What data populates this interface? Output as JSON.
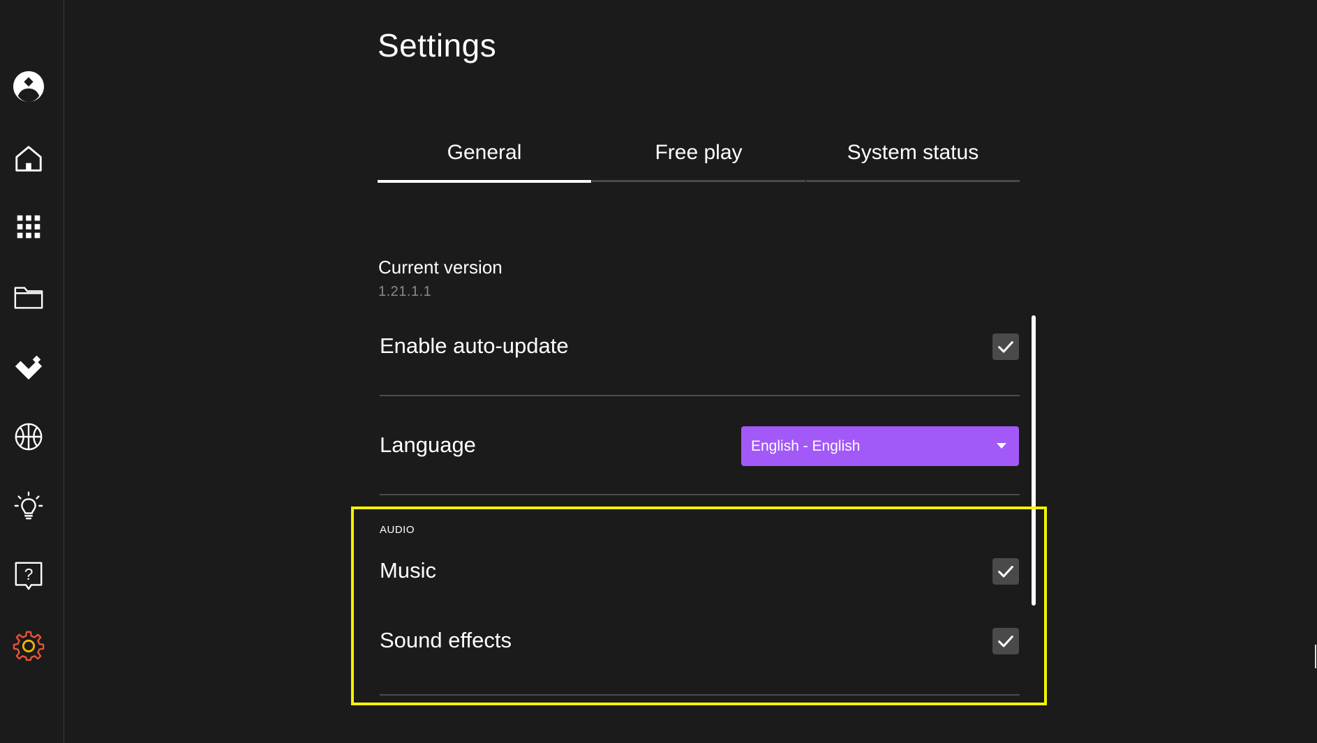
{
  "page": {
    "title": "Settings"
  },
  "sidebar": {
    "items": [
      {
        "icon": "profile-icon"
      },
      {
        "icon": "home-icon"
      },
      {
        "icon": "apps-grid-icon"
      },
      {
        "icon": "folder-icon"
      },
      {
        "icon": "favorites-icon"
      },
      {
        "icon": "basketball-icon"
      },
      {
        "icon": "lightbulb-icon"
      },
      {
        "icon": "help-icon"
      },
      {
        "icon": "settings-gear-icon",
        "active": true,
        "color": "#e8533b",
        "inner_color": "#f2b600"
      }
    ]
  },
  "tabs": [
    {
      "label": "General",
      "active": true
    },
    {
      "label": "Free play",
      "active": false
    },
    {
      "label": "System status",
      "active": false
    }
  ],
  "general": {
    "version_label": "Current version",
    "version_value": "1.21.1.1",
    "auto_update": {
      "label": "Enable auto-update",
      "checked": true
    },
    "language": {
      "label": "Language",
      "selected": "English - English",
      "accent_color": "#a259f7"
    },
    "audio": {
      "section_label": "AUDIO",
      "music": {
        "label": "Music",
        "checked": true
      },
      "sound_effects": {
        "label": "Sound effects",
        "checked": true
      }
    }
  },
  "highlight": {
    "color": "#f4f400"
  }
}
